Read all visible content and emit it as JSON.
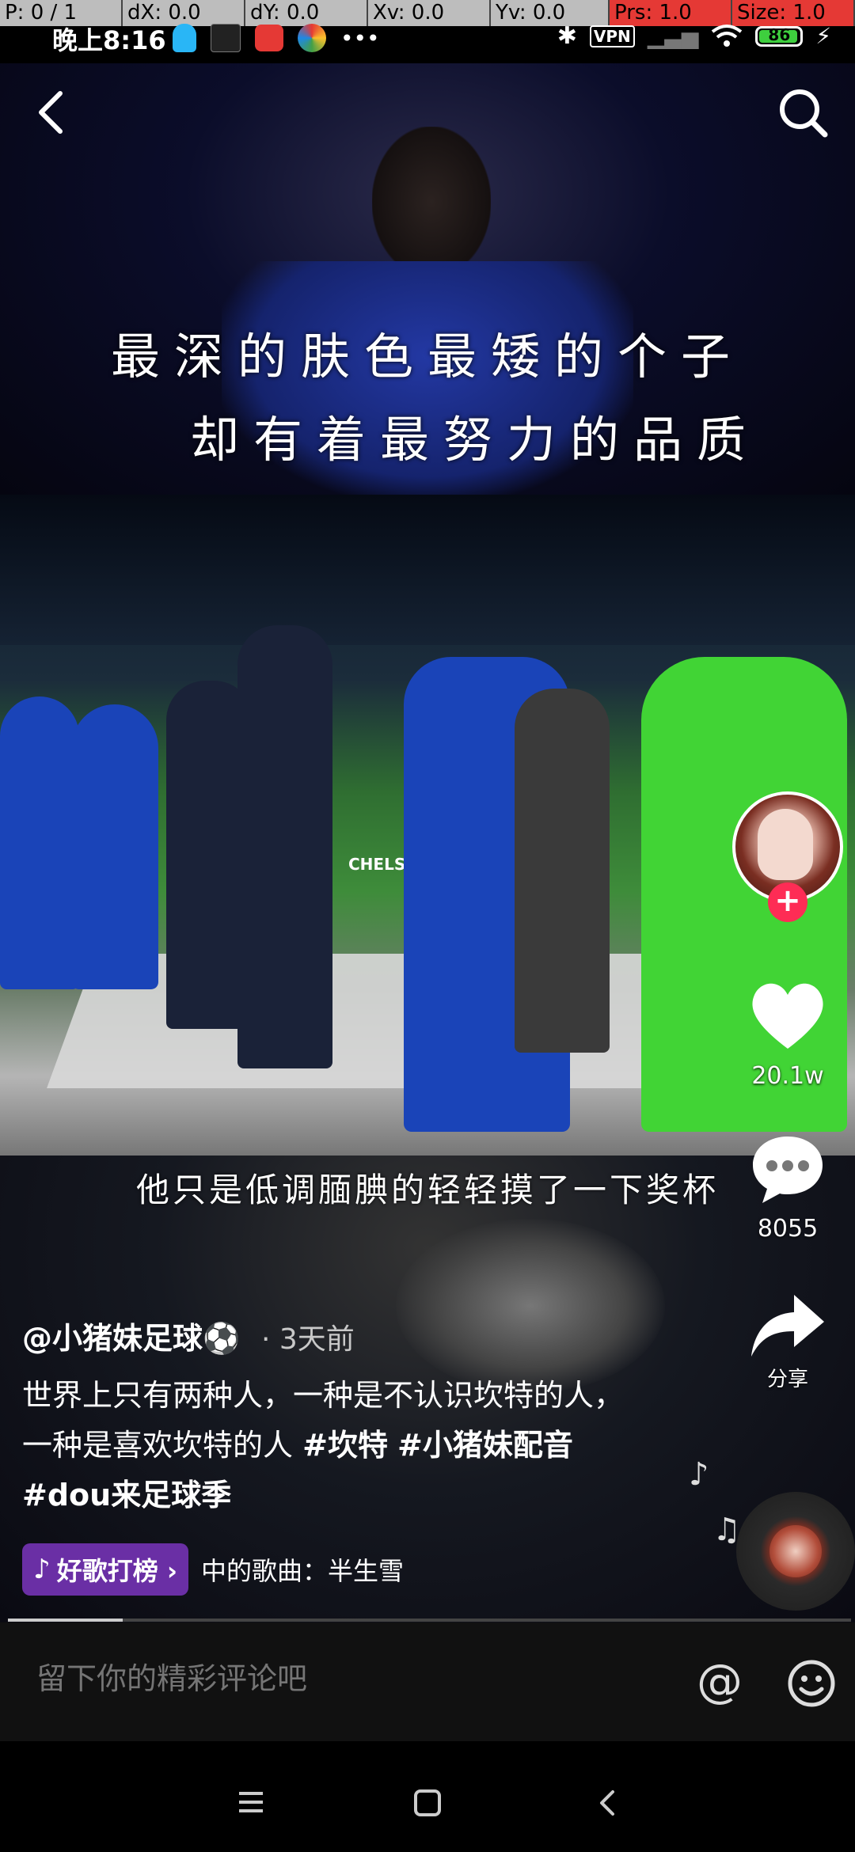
{
  "debug": {
    "p": "P: 0 / 1",
    "dx": "dX: 0.0",
    "dy": "dY: 0.0",
    "xv": "Xv: 0.0",
    "yv": "Yv: 0.0",
    "prs": "Prs: 1.0",
    "size": "Size: 1.0"
  },
  "status": {
    "time": "晚上8:16",
    "battery": "86",
    "vpn": "VPN"
  },
  "video": {
    "caption_line1": "最深的肤色最矮的个子",
    "caption_line2": "却有着最努力的品质",
    "stadium_text": "CHELSEA FC",
    "subtitle": "他只是低调腼腆的轻轻摸了一下奖杯"
  },
  "rail": {
    "likes": "20.1w",
    "comments": "8055",
    "share_label": "分享"
  },
  "post": {
    "author": "@小猪妹足球⚽",
    "time_ago": "· 3天前",
    "desc_text": "世界上只有两种人，一种是不认识坎特的人，一种是喜欢坎特的人",
    "tags": [
      "#坎特",
      "#小猪妹配音",
      "#dou来足球季"
    ]
  },
  "music": {
    "badge": "好歌打榜 ›",
    "text": "中的歌曲：半生雪"
  },
  "comment": {
    "placeholder": "留下你的精彩评论吧"
  },
  "icons": {
    "back": "chevron-left-icon",
    "search": "search-icon",
    "like": "heart-icon",
    "comment": "comment-bubble-icon",
    "share": "share-arrow-icon",
    "at": "at-icon",
    "emoji": "smiley-icon"
  },
  "colors": {
    "accent": "#fe2c55",
    "music_pill": "#6a2fa5"
  }
}
